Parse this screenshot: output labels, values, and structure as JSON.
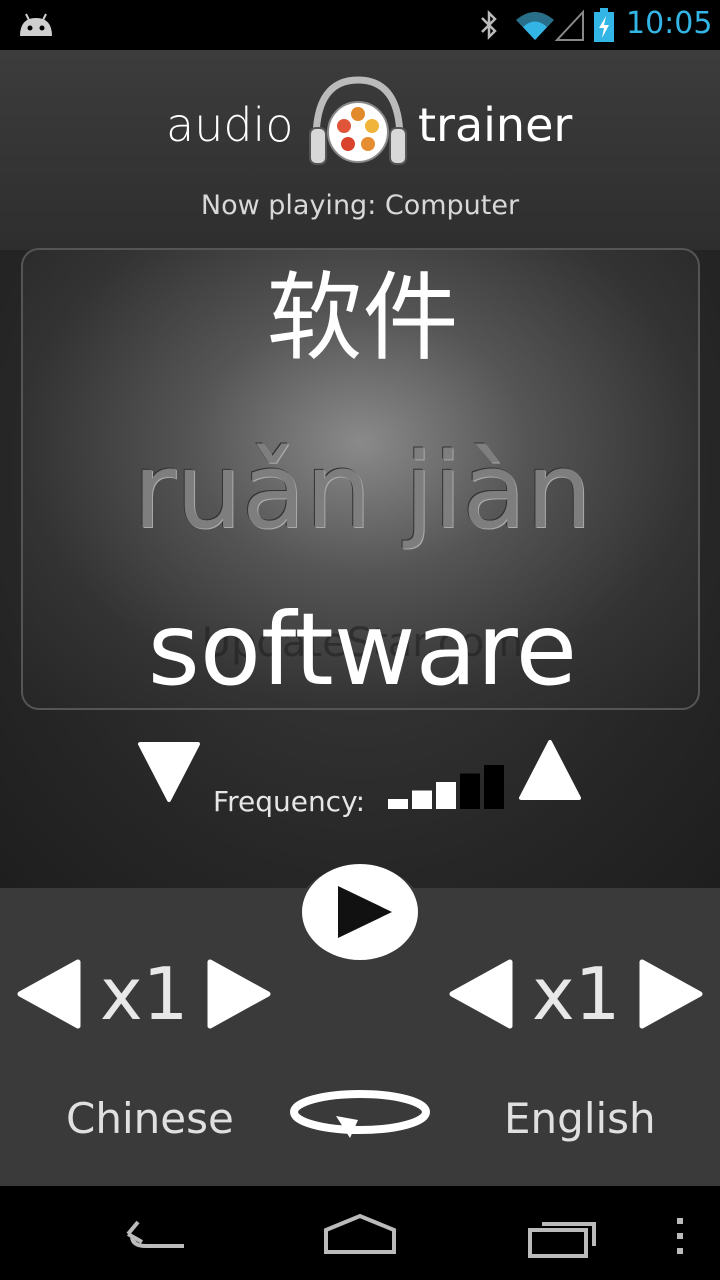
{
  "status_bar": {
    "time": "10:05",
    "icons": [
      "android-icon",
      "bluetooth-icon",
      "wifi-icon",
      "signal-icon",
      "battery-charging-icon"
    ]
  },
  "header": {
    "logo_left": "audio",
    "logo_right": "trainer",
    "now_playing": "Now playing: Computer"
  },
  "card": {
    "hanzi": "软件",
    "pinyin": "ruǎn jiàn",
    "translation": "software",
    "watermark": "UpdateStar.com"
  },
  "frequency": {
    "label": "Frequency:",
    "level": 3,
    "max_level": 5
  },
  "controls": {
    "left_speed": "x1",
    "right_speed": "x1",
    "left_language": "Chinese",
    "right_language": "English"
  },
  "colors": {
    "status_time": "#33b5e5",
    "background": "#3a3a3a"
  }
}
